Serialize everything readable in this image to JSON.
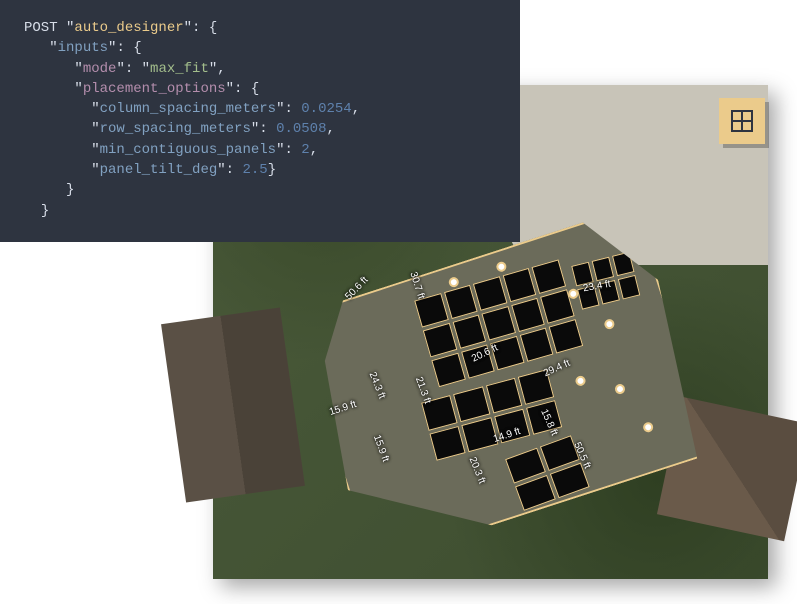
{
  "code": {
    "method": "POST",
    "root_key": "auto_designer",
    "inputs_key": "inputs",
    "mode_key": "mode",
    "mode_value": "max_fit",
    "placement_key": "placement_options",
    "col_spacing_key": "column_spacing_meters",
    "col_spacing_val": "0.0254",
    "row_spacing_key": "row_spacing_meters",
    "row_spacing_val": "0.0508",
    "min_contig_key": "min_contiguous_panels",
    "min_contig_val": "2",
    "tilt_key": "panel_tilt_deg",
    "tilt_val": "2.5"
  },
  "measurements": {
    "m1": "50.6 ft",
    "m2": "30.7 ft",
    "m3": "23.4 ft",
    "m4": "20.6 ft",
    "m5": "29.4 ft",
    "m6": "24.3 ft",
    "m7": "21.3 ft",
    "m8": "15.9 ft",
    "m9": "14.9 ft",
    "m10": "15.8 ft",
    "m11": "20.3 ft",
    "m12": "50.5 ft",
    "m13": "15.9 ft"
  }
}
